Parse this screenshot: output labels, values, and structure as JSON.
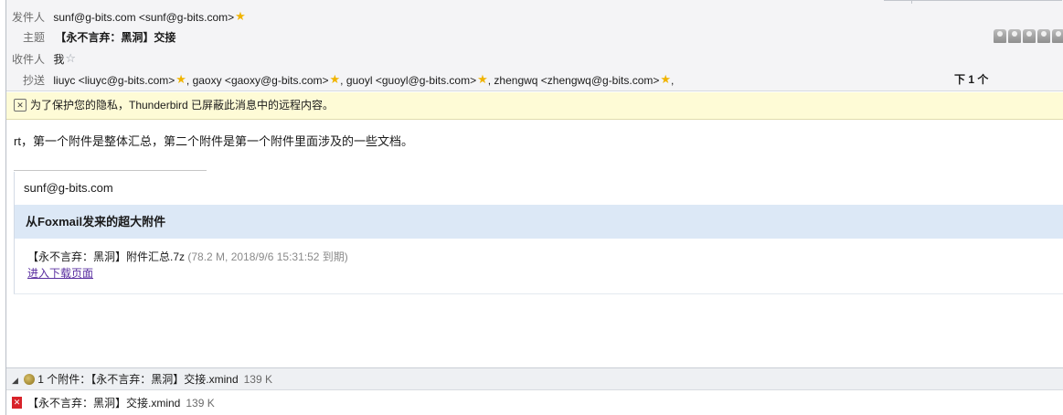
{
  "header": {
    "from_label": "发件人",
    "from_value": "sunf@g-bits.com <sunf@g-bits.com>",
    "subject_label": "主题",
    "subject_value": "【永不言弃：黑洞】交接",
    "to_label": "收件人",
    "to_value": "我",
    "cc_label": "抄送",
    "cc": [
      "liuyc <liuyc@g-bits.com>",
      "gaoxy <gaoxy@g-bits.com>",
      "guoyl <guoyl@g-bits.com>",
      "zhengwq <zhengwq@g-bits.com>"
    ],
    "cc_sep": ", ",
    "cc_trailing": ",",
    "next_label": "下 1 个"
  },
  "notice": {
    "text": "为了保护您的隐私，Thunderbird 已屏蔽此消息中的远程内容。"
  },
  "body": {
    "message": "rt，第一个附件是整体汇总，第二个附件是第一个附件里面涉及的一些文档。",
    "sender": "sunf@g-bits.com",
    "band_title": "从Foxmail发来的超大附件",
    "file_name": "【永不言弃：黑洞】附件汇总.7z",
    "file_meta": "(78.2 M, 2018/9/6 15:31:52 到期)",
    "download_link": "进入下载页面"
  },
  "attachments": {
    "summary": "1 个附件：【永不言弃：黑洞】交接.xmind",
    "summary_size": "139 K",
    "items": [
      {
        "name": "【永不言弃：黑洞】交接.xmind",
        "size": "139 K"
      }
    ]
  },
  "colors": {
    "notice_bg": "#fefbd6",
    "band_bg": "#dce8f6",
    "link": "#5a2fa0",
    "star": "#f0b400"
  }
}
